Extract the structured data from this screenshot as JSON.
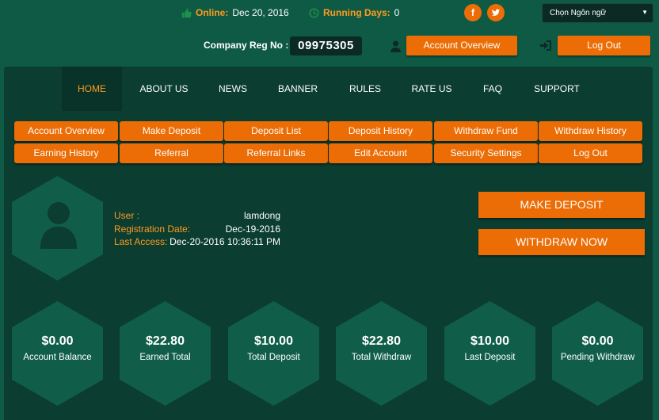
{
  "topbar": {
    "online_label": "Online:",
    "online_value": "Dec 20, 2016",
    "running_label": "Running Days:",
    "running_value": "0",
    "social": [
      "facebook-icon",
      "twitter-icon"
    ],
    "language_select": "Chọn Ngôn ngữ"
  },
  "header": {
    "company_reg_label": "Company Reg No :",
    "company_reg_value": "09975305",
    "account_overview": "Account Overview",
    "logout": "Log Out"
  },
  "nav": [
    "HOME",
    "ABOUT US",
    "NEWS",
    "BANNER",
    "RULES",
    "RATE US",
    "FAQ",
    "SUPPORT"
  ],
  "nav_active": "HOME",
  "subnav": [
    [
      "Account Overview",
      "Make Deposit",
      "Deposit List",
      "Deposit History",
      "Withdraw Fund",
      "Withdraw History"
    ],
    [
      "Earning History",
      "Referral",
      "Referral Links",
      "Edit Account",
      "Security Settings",
      "Log Out"
    ]
  ],
  "profile": {
    "user_label": "User :",
    "user_value": "lamdong",
    "reg_label": "Registration Date:",
    "reg_value": "Dec-19-2016",
    "access_label": "Last Access:",
    "access_value": "Dec-20-2016 10:36:11 PM"
  },
  "actions": {
    "make_deposit": "MAKE DEPOSIT",
    "withdraw_now": "WITHDRAW NOW"
  },
  "stats": [
    {
      "amount": "$0.00",
      "label": "Account Balance"
    },
    {
      "amount": "$22.80",
      "label": "Earned Total"
    },
    {
      "amount": "$10.00",
      "label": "Total Deposit"
    },
    {
      "amount": "$22.80",
      "label": "Total Withdraw"
    },
    {
      "amount": "$10.00",
      "label": "Last Deposit"
    },
    {
      "amount": "$0.00",
      "label": "Pending Withdraw"
    }
  ],
  "colors": {
    "background": "#0f5a45",
    "panel": "#0b3d31",
    "accent": "#ec6d05",
    "label_orange": "#ff9a1f"
  }
}
